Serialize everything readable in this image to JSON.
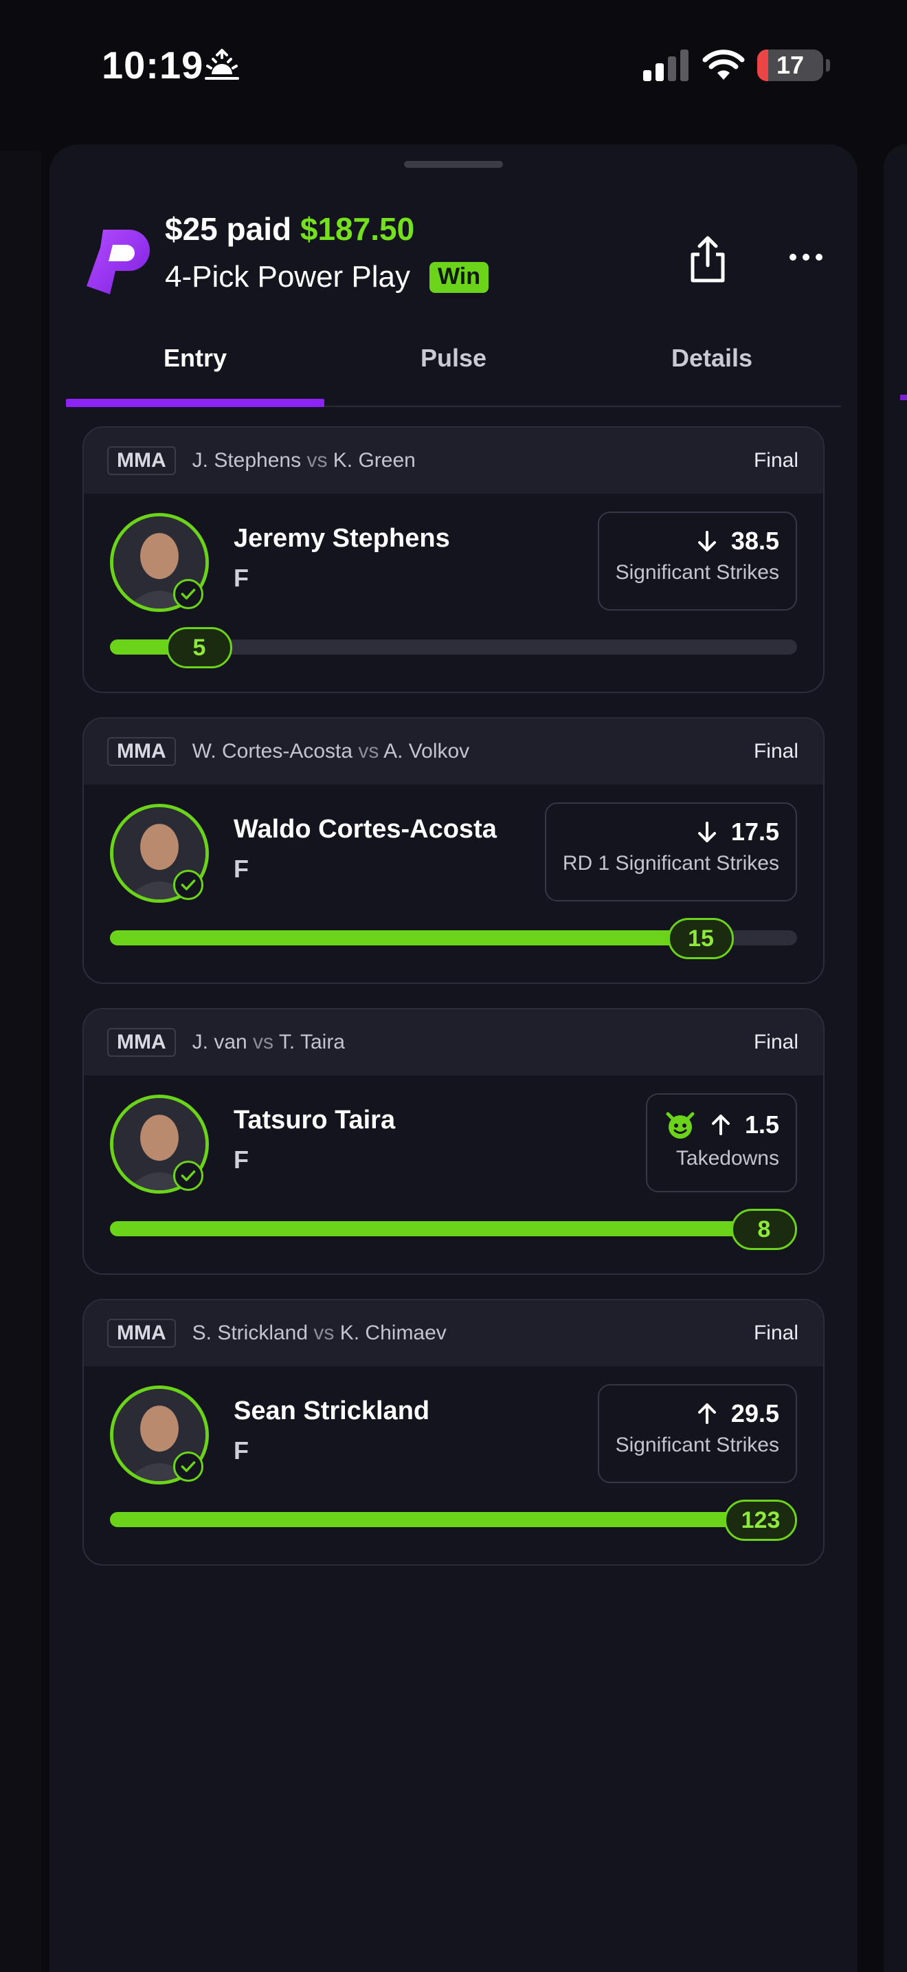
{
  "status_bar": {
    "time": "10:19",
    "battery": "17",
    "battery_level": 0.17,
    "icons": [
      "sunrise-icon",
      "cellular-signal-icon",
      "wifi-icon",
      "battery-icon"
    ]
  },
  "header": {
    "paid_prefix": "$25 paid ",
    "payout": "$187.50",
    "play_type": "4-Pick Power Play",
    "result_badge": "Win",
    "icons": [
      "prizepicks-logo-icon",
      "share-icon",
      "more-icon"
    ]
  },
  "tabs": [
    {
      "label": "Entry",
      "active": true
    },
    {
      "label": "Pulse",
      "active": false
    },
    {
      "label": "Details",
      "active": false
    }
  ],
  "colors": {
    "accent_green": "#6bd31a",
    "accent_purple": "#8e23f5",
    "card_bg": "#13141d",
    "card_header_bg": "#1e1f2b"
  },
  "picks": [
    {
      "league": "MMA",
      "fighter_a": "J. Stephens",
      "vs": "vs",
      "fighter_b": "K. Green",
      "status": "Final",
      "player": "Jeremy Stephens",
      "position": "F",
      "direction": "down",
      "line": "38.5",
      "stat": "Significant Strikes",
      "result": "5",
      "progress": 0.13,
      "devil": false
    },
    {
      "league": "MMA",
      "fighter_a": "W. Cortes-Acosta",
      "vs": "vs",
      "fighter_b": "A. Volkov",
      "status": "Final",
      "player": "Waldo Cortes-Acosta",
      "position": "F",
      "direction": "down",
      "line": "17.5",
      "stat": "RD 1 Significant Strikes",
      "result": "15",
      "progress": 0.86,
      "devil": false
    },
    {
      "league": "MMA",
      "fighter_a": "J. van",
      "vs": "vs",
      "fighter_b": "T. Taira",
      "status": "Final",
      "player": "Tatsuro Taira",
      "position": "F",
      "direction": "up",
      "line": "1.5",
      "stat": "Takedowns",
      "result": "8",
      "progress": 1.0,
      "devil": true
    },
    {
      "league": "MMA",
      "fighter_a": "S. Strickland",
      "vs": "vs",
      "fighter_b": "K. Chimaev",
      "status": "Final",
      "player": "Sean Strickland",
      "position": "F",
      "direction": "up",
      "line": "29.5",
      "stat": "Significant Strikes",
      "result": "123",
      "progress": 1.0,
      "devil": false
    }
  ]
}
